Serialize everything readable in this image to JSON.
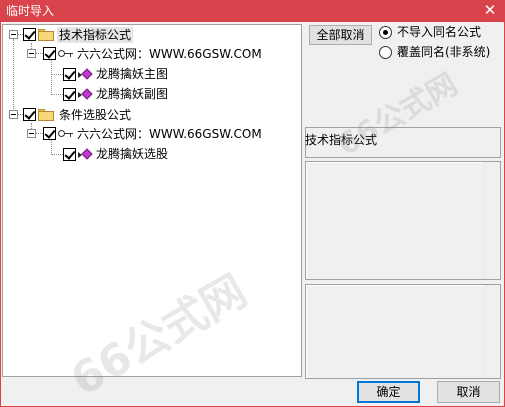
{
  "window": {
    "title": "临时导入",
    "close_glyph": "✕"
  },
  "tree": {
    "groups": [
      {
        "label": "技术指标公式",
        "source": "六六公式网：WWW.66GSW.COM",
        "items": [
          "龙腾擒妖主图",
          "龙腾擒妖副图"
        ]
      },
      {
        "label": "条件选股公式",
        "source": "六六公式网：WWW.66GSW.COM",
        "items": [
          "龙腾擒妖选股"
        ]
      }
    ]
  },
  "options": {
    "deselect_all_label": "全部取消",
    "radio_skip_label": "不导入同名公式",
    "radio_overwrite_label": "覆盖同名(非系统)",
    "selected": "skip"
  },
  "info": {
    "category_label": "技术指标公式"
  },
  "footer": {
    "ok_label": "确定",
    "cancel_label": "取消"
  },
  "watermark": {
    "text": "66公式网"
  },
  "icons": [
    "close-icon",
    "folder-icon",
    "key-icon",
    "formula-item-icon",
    "collapse-icon",
    "checkbox-checked-icon"
  ]
}
